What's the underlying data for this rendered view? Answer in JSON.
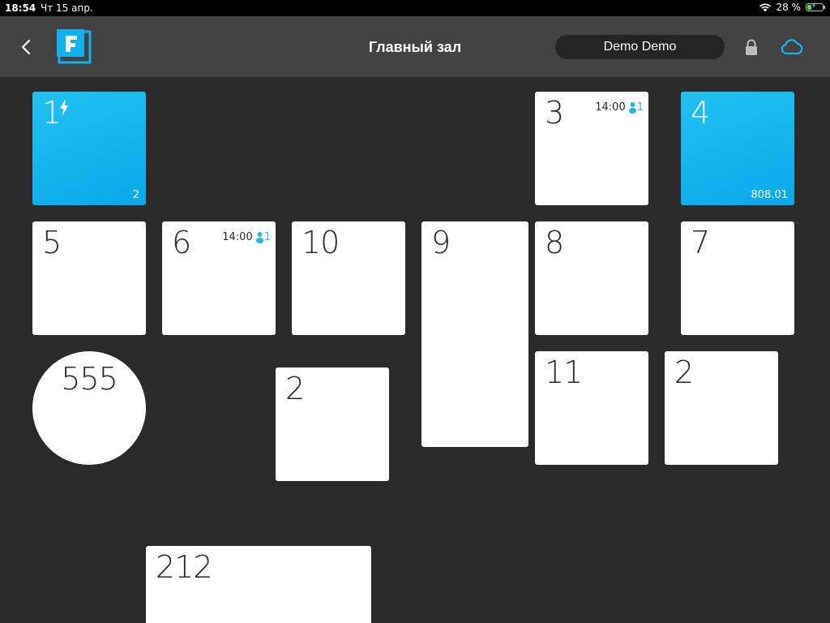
{
  "status_bar": {
    "time": "18:54",
    "date": "Чт 15 апр.",
    "battery_percent": "28 %",
    "battery_level": 0.28
  },
  "header": {
    "title": "Главный зал",
    "user_name": "Demo Demo"
  },
  "colors": {
    "accent": "#12b3ef",
    "header_bg": "#424242",
    "floor_bg": "#2a2a2a"
  },
  "tables": [
    {
      "number": "1",
      "sum": "2",
      "active": true,
      "busy_icon": "lightning-icon"
    },
    {
      "number": "3",
      "time": "14:00",
      "guests": "1"
    },
    {
      "number": "4",
      "sum": "808.01",
      "active": true
    },
    {
      "number": "5"
    },
    {
      "number": "6",
      "time": "14:00",
      "guests": "1"
    },
    {
      "number": "10"
    },
    {
      "number": "9"
    },
    {
      "number": "8"
    },
    {
      "number": "7"
    },
    {
      "number": "555",
      "shape": "round"
    },
    {
      "number": "2"
    },
    {
      "number": "11"
    },
    {
      "number": "2"
    },
    {
      "number": "212"
    }
  ]
}
